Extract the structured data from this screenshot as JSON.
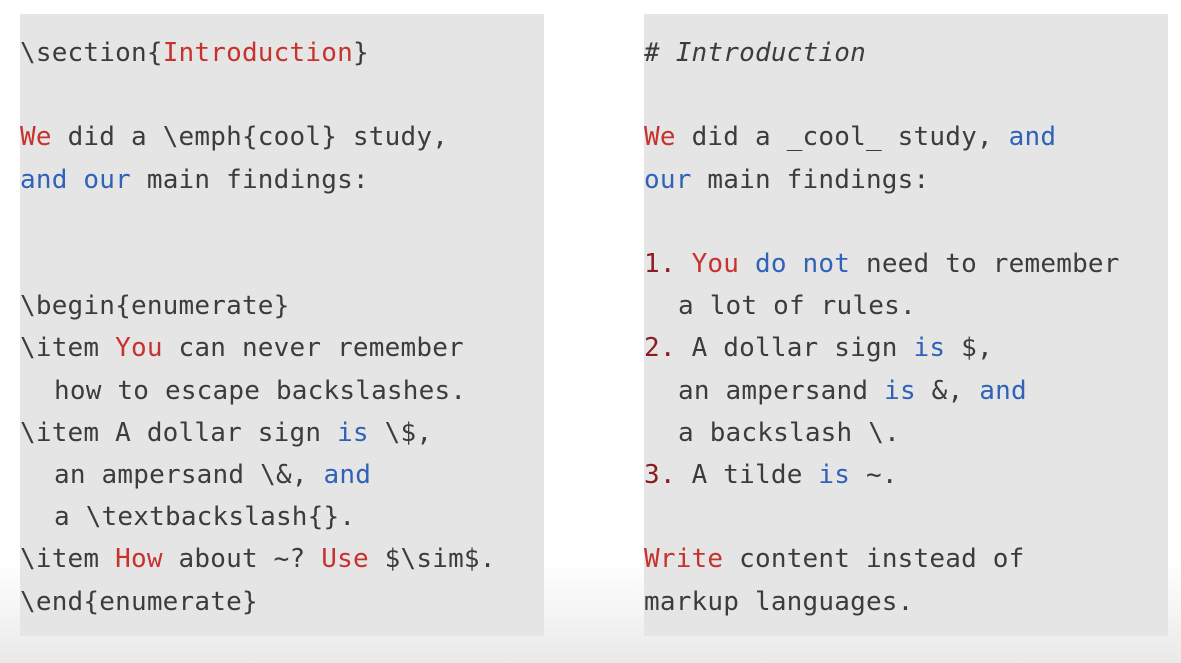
{
  "colors": {
    "panel_bg": "#e5e5e5",
    "text": "#3c3c3c",
    "keyword_red": "#c8322e",
    "keyword_blue": "#2f62b8",
    "number_dark_red": "#8a1c22"
  },
  "latex": {
    "lines": [
      [
        {
          "t": "\\section{"
        },
        {
          "t": "Introduction",
          "c": "red"
        },
        {
          "t": "}"
        }
      ],
      [],
      [
        {
          "t": "We",
          "c": "red"
        },
        {
          "t": " did a \\emph{cool} study,"
        }
      ],
      [
        {
          "t": "and our",
          "c": "blue"
        },
        {
          "t": " main findings:"
        }
      ],
      [],
      [],
      [
        {
          "t": "\\begin{enumerate}"
        }
      ],
      [
        {
          "t": "\\item "
        },
        {
          "t": "You",
          "c": "red"
        },
        {
          "t": " can never remember"
        }
      ],
      [
        {
          "t": "how to escape backslashes.",
          "indent": true
        }
      ],
      [
        {
          "t": "\\item A dollar sign "
        },
        {
          "t": "is",
          "c": "blue"
        },
        {
          "t": " \\$,"
        }
      ],
      [
        {
          "t": "an ampersand \\&, ",
          "indent": true
        },
        {
          "t": "and",
          "c": "blue"
        }
      ],
      [
        {
          "t": "a \\textbackslash{}.",
          "indent": true
        }
      ],
      [
        {
          "t": "\\item "
        },
        {
          "t": "How",
          "c": "red"
        },
        {
          "t": " about ~? "
        },
        {
          "t": "Use",
          "c": "red"
        },
        {
          "t": " $\\sim$."
        }
      ],
      [
        {
          "t": "\\end{enumerate}"
        }
      ]
    ]
  },
  "markdown": {
    "lines": [
      [
        {
          "t": "# Introduction",
          "italic": true
        }
      ],
      [],
      [
        {
          "t": "We",
          "c": "red"
        },
        {
          "t": " did a _cool_ study, "
        },
        {
          "t": "and",
          "c": "blue"
        }
      ],
      [
        {
          "t": "our",
          "c": "blue"
        },
        {
          "t": " main findings:"
        }
      ],
      [],
      [
        {
          "t": "1.",
          "c": "num"
        },
        {
          "t": " "
        },
        {
          "t": "You",
          "c": "red"
        },
        {
          "t": " "
        },
        {
          "t": "do not",
          "c": "blue"
        },
        {
          "t": " need to remember"
        }
      ],
      [
        {
          "t": "a lot of rules.",
          "indent": true
        }
      ],
      [
        {
          "t": "2.",
          "c": "num"
        },
        {
          "t": " A dollar sign "
        },
        {
          "t": "is",
          "c": "blue"
        },
        {
          "t": " $,"
        }
      ],
      [
        {
          "t": "an ampersand ",
          "indent": true
        },
        {
          "t": "is",
          "c": "blue"
        },
        {
          "t": " &, "
        },
        {
          "t": "and",
          "c": "blue"
        }
      ],
      [
        {
          "t": "a backslash \\.",
          "indent": true
        }
      ],
      [
        {
          "t": "3.",
          "c": "num"
        },
        {
          "t": " A tilde "
        },
        {
          "t": "is",
          "c": "blue"
        },
        {
          "t": " ~."
        }
      ],
      [],
      [
        {
          "t": "Write",
          "c": "red"
        },
        {
          "t": " content instead of"
        }
      ],
      [
        {
          "t": "markup languages."
        }
      ]
    ]
  }
}
